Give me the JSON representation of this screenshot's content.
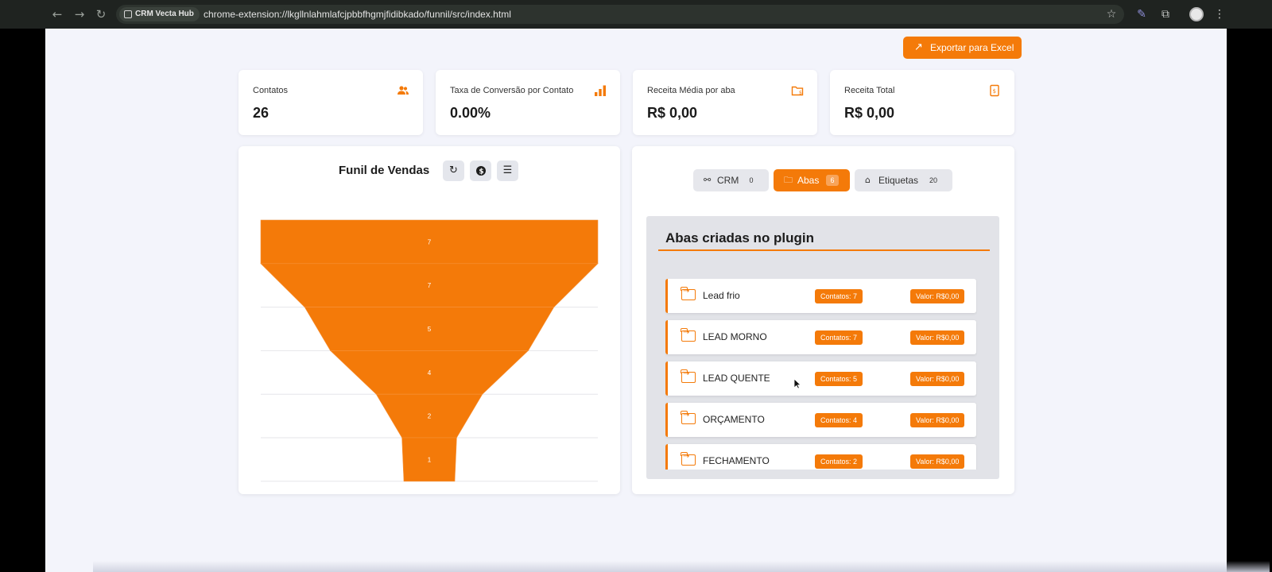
{
  "browser": {
    "site_chip": "CRM Vecta Hub",
    "url": "chrome-extension://lkgllnlahmlafcjpbbfhgmjfidibkado/funnil/src/index.html"
  },
  "header": {
    "export_label": "Exportar para Excel"
  },
  "stats": [
    {
      "label": "Contatos",
      "value": "26",
      "icon": "users-icon"
    },
    {
      "label": "Taxa de Conversão por Contato",
      "value": "0.00%",
      "icon": "bar-chart-icon"
    },
    {
      "label": "Receita Média por aba",
      "value": "R$ 0,00",
      "icon": "folder-money-icon"
    },
    {
      "label": "Receita Total",
      "value": "R$ 0,00",
      "icon": "receipt-icon"
    }
  ],
  "funnel": {
    "title": "Funil de Vendas",
    "tools": [
      "refresh-icon",
      "dollar-icon",
      "sort-icon"
    ]
  },
  "chart_data": {
    "type": "bar",
    "title": "Funil de Vendas",
    "categories": [
      "Lead frio",
      "LEAD MORNO",
      "LEAD QUENTE",
      "ORÇAMENTO",
      "FECHAMENTO",
      ""
    ],
    "values": [
      7,
      7,
      5,
      4,
      2,
      1
    ],
    "orientation": "funnel",
    "color": "#f47a09"
  },
  "tabs": [
    {
      "label": "CRM",
      "count": "0",
      "active": false,
      "icon": "crm-icon"
    },
    {
      "label": "Abas",
      "count": "6",
      "active": true,
      "icon": "folder-icon"
    },
    {
      "label": "Etiquetas",
      "count": "20",
      "active": false,
      "icon": "tag-icon"
    }
  ],
  "abas": {
    "title": "Abas criadas no plugin",
    "items": [
      {
        "name": "Lead frio",
        "contacts": "Contatos: 7",
        "value": "Valor: R$0,00"
      },
      {
        "name": "LEAD MORNO",
        "contacts": "Contatos: 7",
        "value": "Valor: R$0,00"
      },
      {
        "name": "LEAD QUENTE",
        "contacts": "Contatos: 5",
        "value": "Valor: R$0,00"
      },
      {
        "name": "ORÇAMENTO",
        "contacts": "Contatos: 4",
        "value": "Valor: R$0,00"
      },
      {
        "name": "FECHAMENTO",
        "contacts": "Contatos: 2",
        "value": "Valor: R$0,00"
      }
    ]
  },
  "colors": {
    "accent": "#f47a09",
    "background": "#f3f4fb"
  }
}
